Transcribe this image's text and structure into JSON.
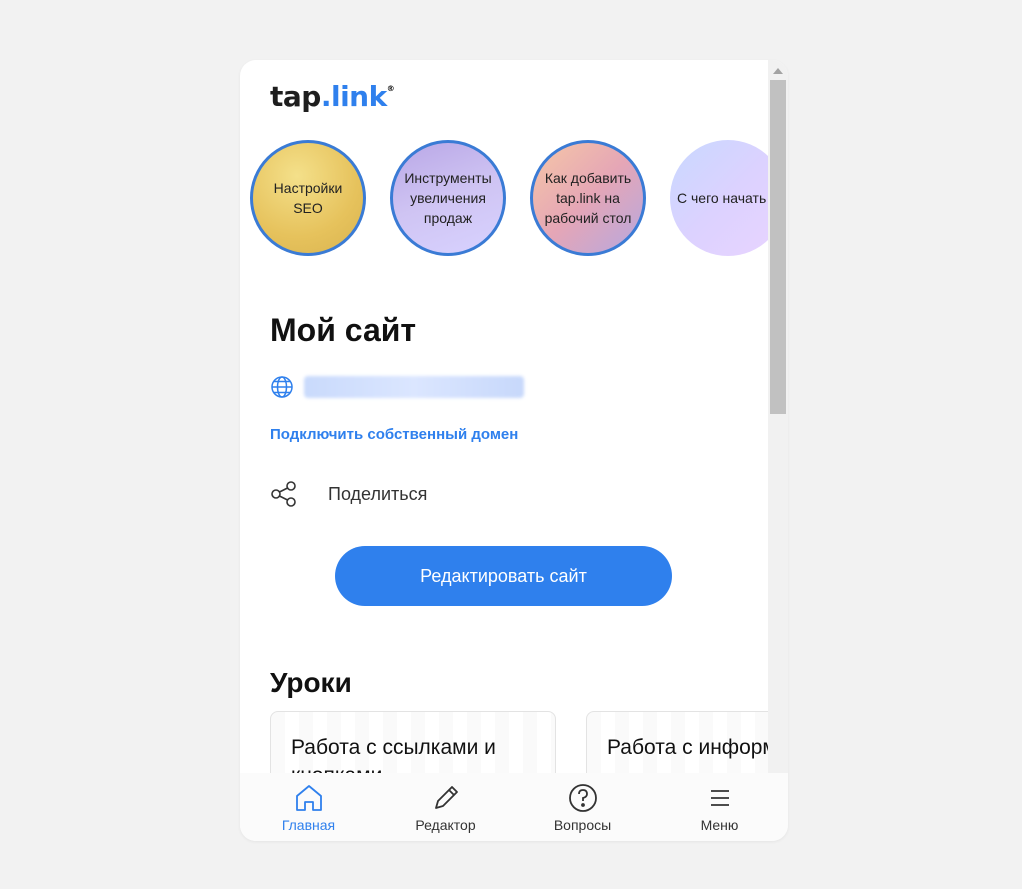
{
  "logo": {
    "tap": "tap",
    "dot_link": ".link",
    "reg": "®"
  },
  "stories": [
    {
      "label": "Настройки SEO"
    },
    {
      "label": "Инструменты увеличения продаж"
    },
    {
      "label": "Как добавить tap.link на рабочий стол"
    },
    {
      "label": "С чего начать"
    }
  ],
  "site": {
    "title": "Мой сайт",
    "connect_domain": "Подключить собственный домен",
    "share": "Поделиться",
    "edit_button": "Редактировать сайт"
  },
  "lessons": {
    "title": "Уроки",
    "cards": [
      {
        "title": "Работа с ссылками и кнопками"
      },
      {
        "title": "Работа с информацией"
      }
    ]
  },
  "nav": {
    "items": [
      {
        "label": "Главная",
        "icon": "home-icon"
      },
      {
        "label": "Редактор",
        "icon": "pencil-icon"
      },
      {
        "label": "Вопросы",
        "icon": "question-icon"
      },
      {
        "label": "Меню",
        "icon": "menu-icon"
      }
    ]
  },
  "colors": {
    "accent": "#2f80ed",
    "story_border": "#3a7bd5"
  }
}
